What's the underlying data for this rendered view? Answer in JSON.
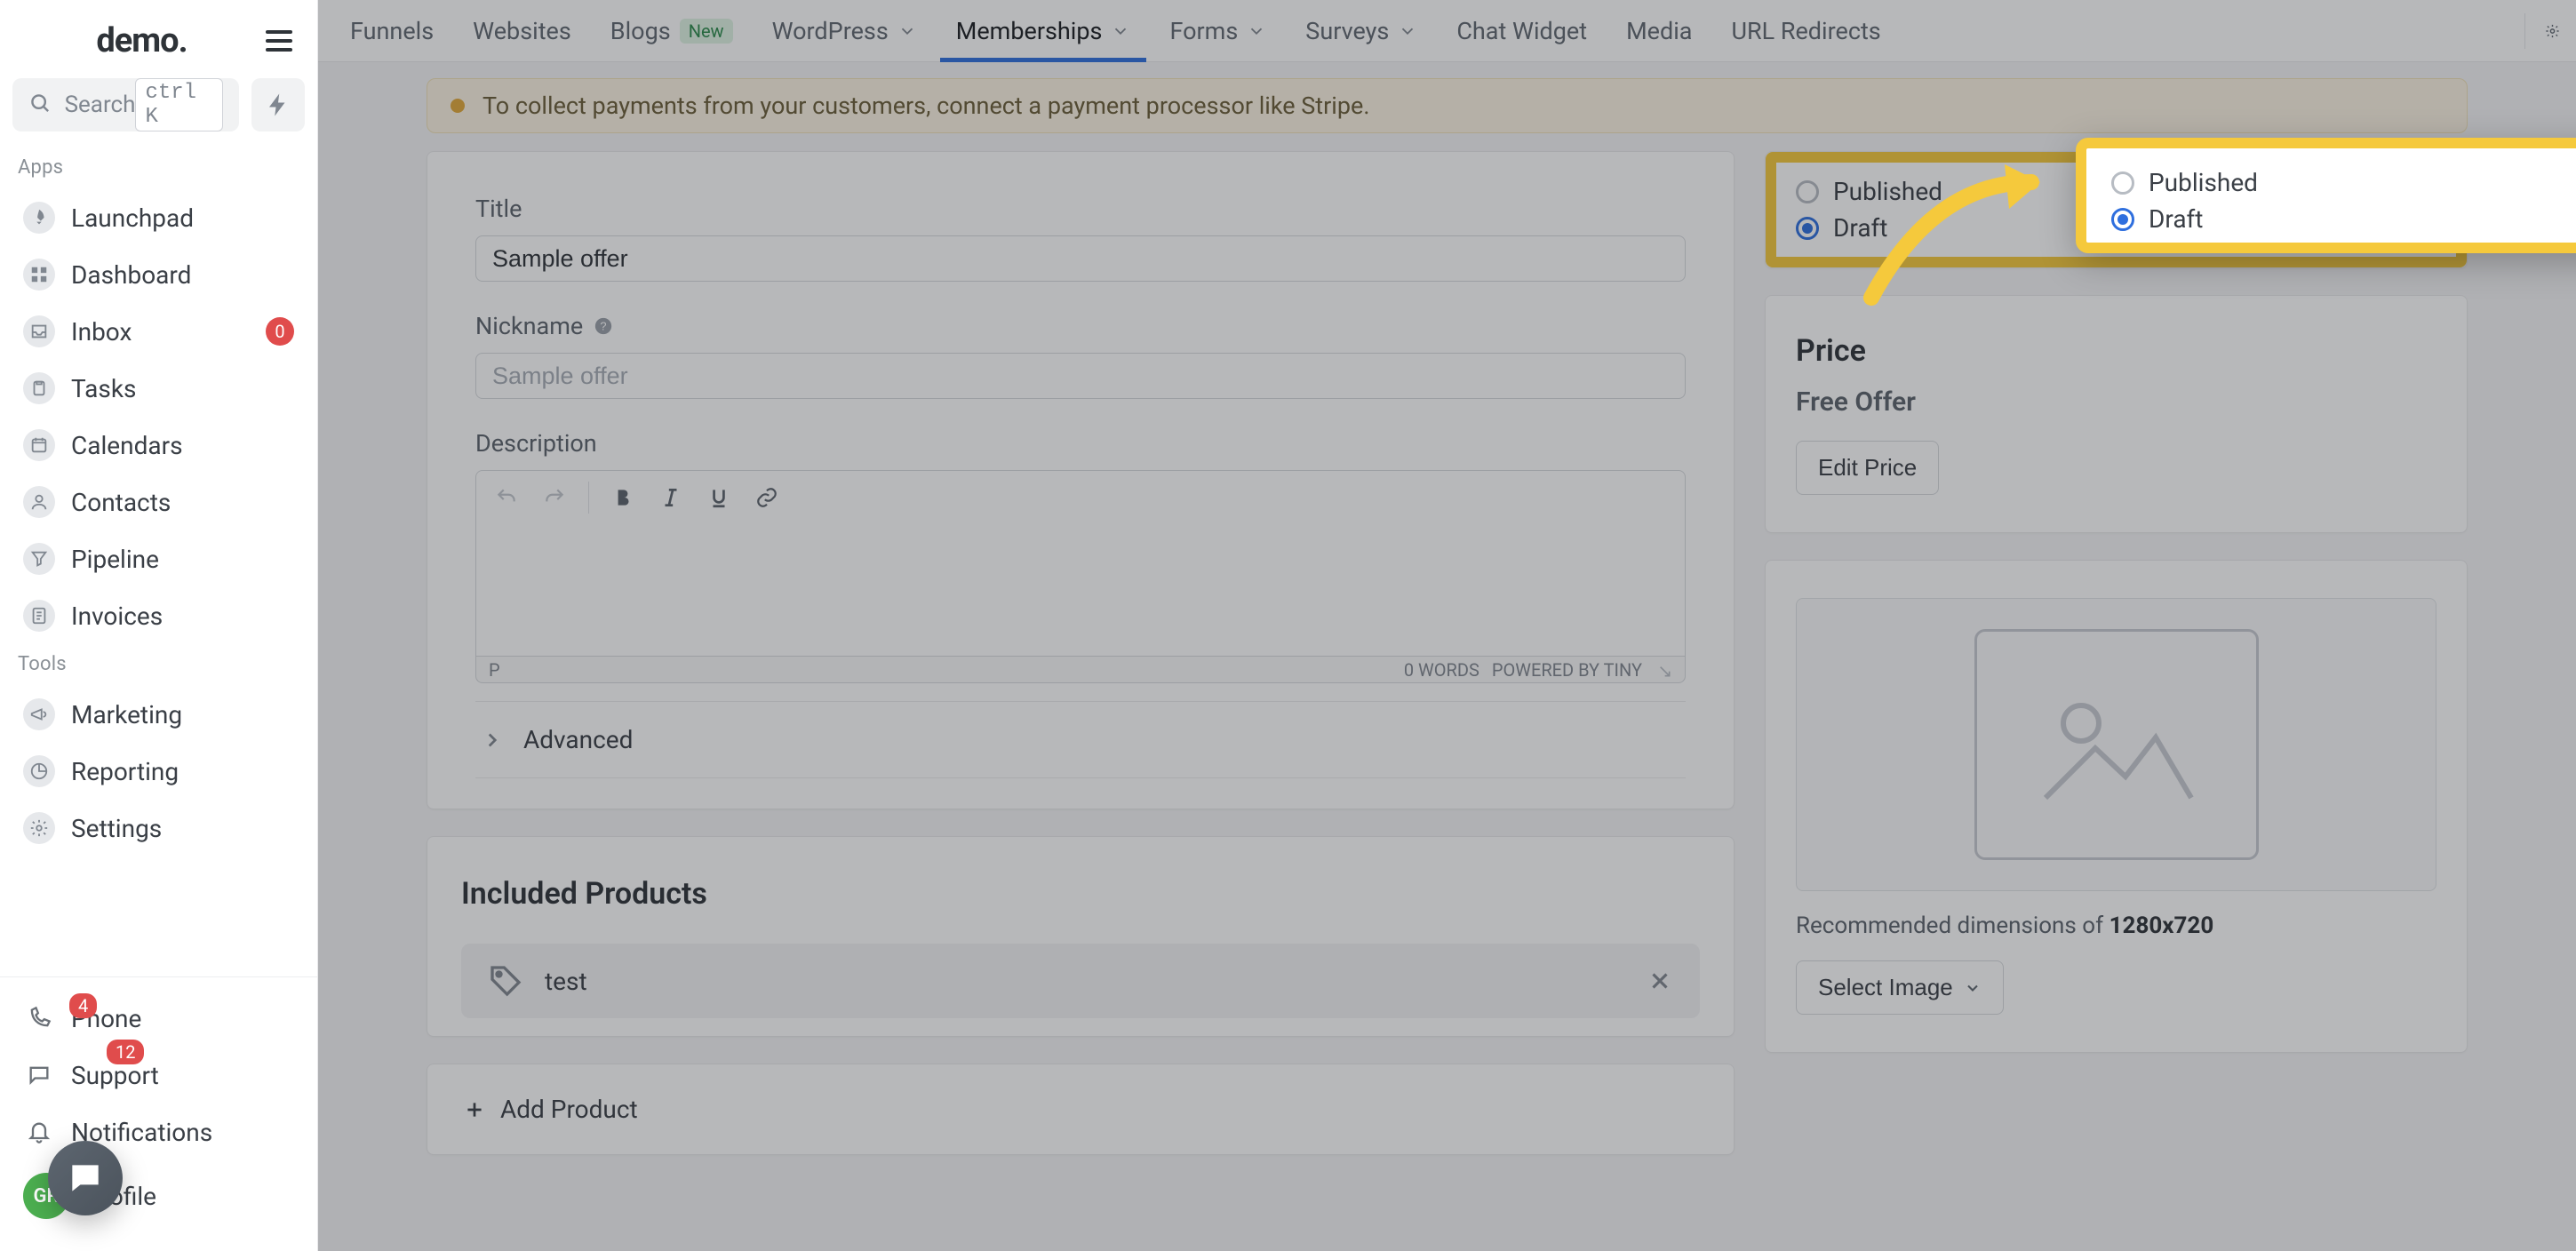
{
  "brand": {
    "logo_text": "demo."
  },
  "search": {
    "placeholder": "Search",
    "shortcut": "ctrl K"
  },
  "sidebar": {
    "section_apps": "Apps",
    "section_tools": "Tools",
    "apps": [
      {
        "label": "Launchpad"
      },
      {
        "label": "Dashboard"
      },
      {
        "label": "Inbox",
        "badge": "0"
      },
      {
        "label": "Tasks"
      },
      {
        "label": "Calendars"
      },
      {
        "label": "Contacts"
      },
      {
        "label": "Pipeline"
      },
      {
        "label": "Invoices"
      }
    ],
    "tools": [
      {
        "label": "Marketing"
      },
      {
        "label": "Reporting"
      },
      {
        "label": "Settings"
      }
    ],
    "footer": [
      {
        "label": "Phone"
      },
      {
        "label": "Support"
      },
      {
        "label": "Notifications",
        "badge_a": "4",
        "badge_b": "12"
      },
      {
        "label": "Profile",
        "avatar": "GR"
      }
    ]
  },
  "topbar": {
    "tabs": [
      {
        "label": "Funnels"
      },
      {
        "label": "Websites"
      },
      {
        "label": "Blogs",
        "pill": "New"
      },
      {
        "label": "WordPress",
        "chev": true
      },
      {
        "label": "Memberships",
        "chev": true,
        "active": true
      },
      {
        "label": "Forms",
        "chev": true
      },
      {
        "label": "Surveys",
        "chev": true
      },
      {
        "label": "Chat Widget"
      },
      {
        "label": "Media"
      },
      {
        "label": "URL Redirects"
      }
    ]
  },
  "alert": {
    "text": "To collect payments from your customers, connect a payment processor like Stripe."
  },
  "form": {
    "title_label": "Title",
    "title_value": "Sample offer",
    "nickname_label": "Nickname",
    "nickname_placeholder": "Sample offer",
    "description_label": "Description",
    "editor_path": "P",
    "editor_words": "0 WORDS",
    "editor_powered": "POWERED BY TINY",
    "advanced_label": "Advanced"
  },
  "products": {
    "heading": "Included Products",
    "items": [
      {
        "name": "test"
      }
    ],
    "add_label": "Add Product"
  },
  "status": {
    "published_label": "Published",
    "draft_label": "Draft",
    "selected": "draft"
  },
  "price": {
    "heading": "Price",
    "subheading": "Free Offer",
    "edit_label": "Edit Price"
  },
  "image": {
    "note_prefix": "Recommended dimensions of ",
    "note_dim": "1280x720",
    "select_label": "Select Image"
  }
}
